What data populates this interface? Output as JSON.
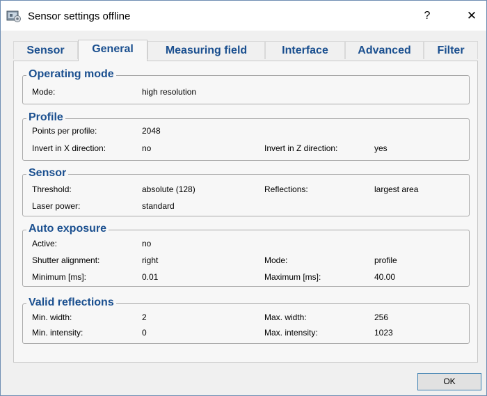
{
  "window": {
    "title": "Sensor settings offline",
    "help_symbol": "?",
    "close_symbol": "✕",
    "icon": "sensor-app-icon"
  },
  "tabs": [
    {
      "label": "Sensor",
      "active": false
    },
    {
      "label": "General",
      "active": true
    },
    {
      "label": "Measuring field",
      "active": false
    },
    {
      "label": "Interface",
      "active": false
    },
    {
      "label": "Advanced",
      "active": false
    },
    {
      "label": "Filter",
      "active": false
    }
  ],
  "groups": {
    "operating_mode": {
      "title": "Operating mode",
      "mode_label": "Mode:",
      "mode_value": "high resolution"
    },
    "profile": {
      "title": "Profile",
      "points_label": "Points per profile:",
      "points_value": "2048",
      "invert_x_label": "Invert in X direction:",
      "invert_x_value": "no",
      "invert_z_label": "Invert in Z direction:",
      "invert_z_value": "yes"
    },
    "sensor": {
      "title": "Sensor",
      "threshold_label": "Threshold:",
      "threshold_value": "absolute (128)",
      "reflections_label": "Reflections:",
      "reflections_value": "largest area",
      "laser_label": "Laser power:",
      "laser_value": "standard"
    },
    "auto_exposure": {
      "title": "Auto exposure",
      "active_label": "Active:",
      "active_value": "no",
      "shutter_label": "Shutter alignment:",
      "shutter_value": "right",
      "mode_label": "Mode:",
      "mode_value": "profile",
      "min_label": "Minimum [ms]:",
      "min_value": "0.01",
      "max_label": "Maximum [ms]:",
      "max_value": "40.00"
    },
    "valid_reflections": {
      "title": "Valid reflections",
      "min_width_label": "Min. width:",
      "min_width_value": "2",
      "max_width_label": "Max. width:",
      "max_width_value": "256",
      "min_int_label": "Min. intensity:",
      "min_int_value": "0",
      "max_int_label": "Max. intensity:",
      "max_int_value": "1023"
    }
  },
  "footer": {
    "ok_label": "OK"
  }
}
